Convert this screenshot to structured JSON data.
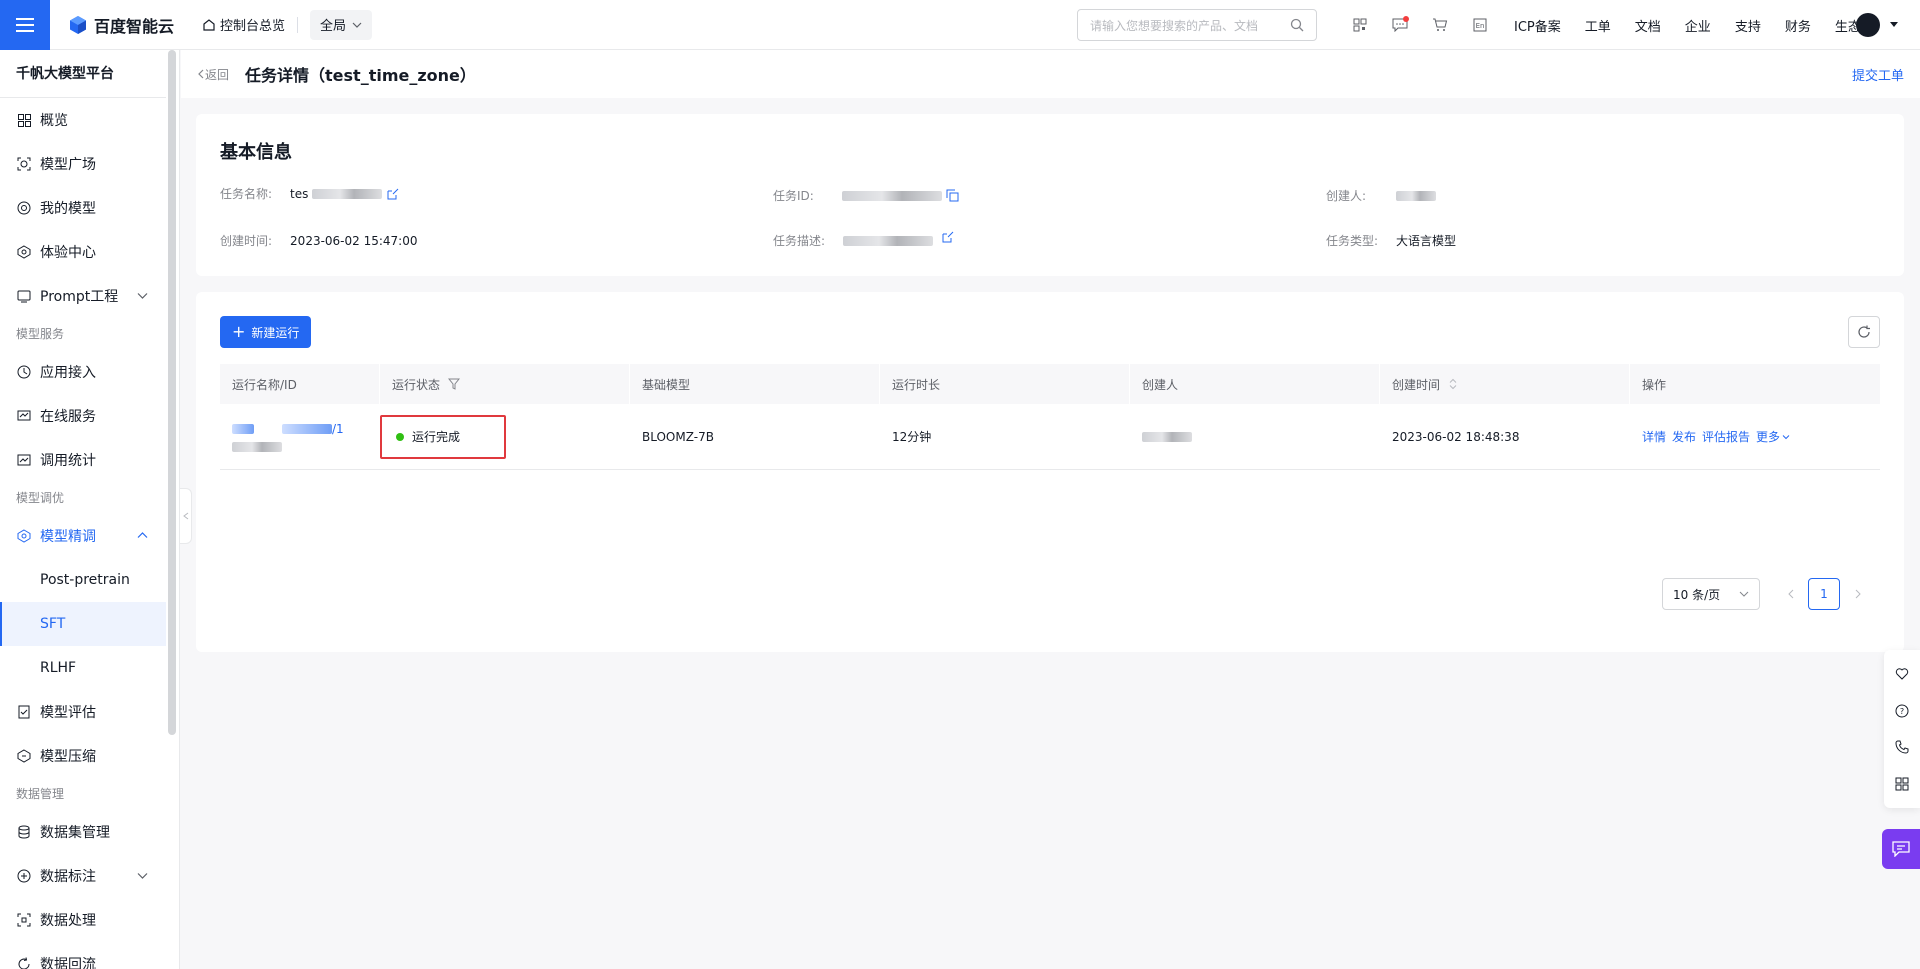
{
  "topbar": {
    "brand": "百度智能云",
    "home_label": "控制台总览",
    "region_label": "全局",
    "search_placeholder": "请输入您想要搜索的产品、文档",
    "links": [
      "ICP备案",
      "工单",
      "文档",
      "企业",
      "支持",
      "财务",
      "生态"
    ]
  },
  "sidebar": {
    "title": "千帆大模型平台",
    "items": [
      {
        "label": "概览",
        "icon": "grid-icon"
      },
      {
        "label": "模型广场",
        "icon": "plaza-icon"
      },
      {
        "label": "我的模型",
        "icon": "model-icon"
      },
      {
        "label": "体验中心",
        "icon": "experience-icon"
      },
      {
        "label": "Prompt工程",
        "icon": "prompt-icon"
      }
    ],
    "group_service": "模型服务",
    "service_items": [
      {
        "label": "应用接入",
        "icon": "app-icon"
      },
      {
        "label": "在线服务",
        "icon": "service-icon"
      },
      {
        "label": "调用统计",
        "icon": "stats-icon"
      }
    ],
    "group_tuning": "模型调优",
    "tuning_parent": "模型精调",
    "tuning_subs": [
      "Post-pretrain",
      "SFT",
      "RLHF"
    ],
    "more_items": [
      {
        "label": "模型评估",
        "icon": "eval-icon"
      },
      {
        "label": "模型压缩",
        "icon": "compress-icon"
      }
    ],
    "group_data": "数据管理",
    "data_items": [
      {
        "label": "数据集管理",
        "icon": "dataset-icon"
      },
      {
        "label": "数据标注",
        "icon": "label-icon"
      },
      {
        "label": "数据处理",
        "icon": "process-icon"
      },
      {
        "label": "数据回流",
        "icon": "reflow-icon"
      }
    ]
  },
  "header": {
    "back_label": "返回",
    "title": "任务详情（test_time_zone）",
    "submit_ticket": "提交工单"
  },
  "basic_info": {
    "title": "基本信息",
    "task_name_label": "任务名称:",
    "task_name_value": "tes",
    "task_id_label": "任务ID:",
    "creator_label": "创建人:",
    "created_time_label": "创建时间:",
    "created_time_value": "2023-06-02 15:47:00",
    "task_desc_label": "任务描述:",
    "task_type_label": "任务类型:",
    "task_type_value": "大语言模型"
  },
  "runs": {
    "new_run_label": "新建运行",
    "columns": [
      "运行名称/ID",
      "运行状态",
      "基础模型",
      "运行时长",
      "创建人",
      "创建时间",
      "操作"
    ],
    "rows": [
      {
        "name_suffix": "/1",
        "status": "运行完成",
        "base_model": "BLOOMZ-7B",
        "duration": "12分钟",
        "created_time": "2023-06-02 18:48:38",
        "ops": [
          "详情",
          "发布",
          "评估报告",
          "更多"
        ]
      }
    ],
    "page_size": "10 条/页",
    "current_page": "1"
  },
  "colors": {
    "primary": "#2468f2",
    "success": "#30bf13",
    "highlight_border": "#e0393e",
    "chat_float": "#7a3cf0"
  }
}
